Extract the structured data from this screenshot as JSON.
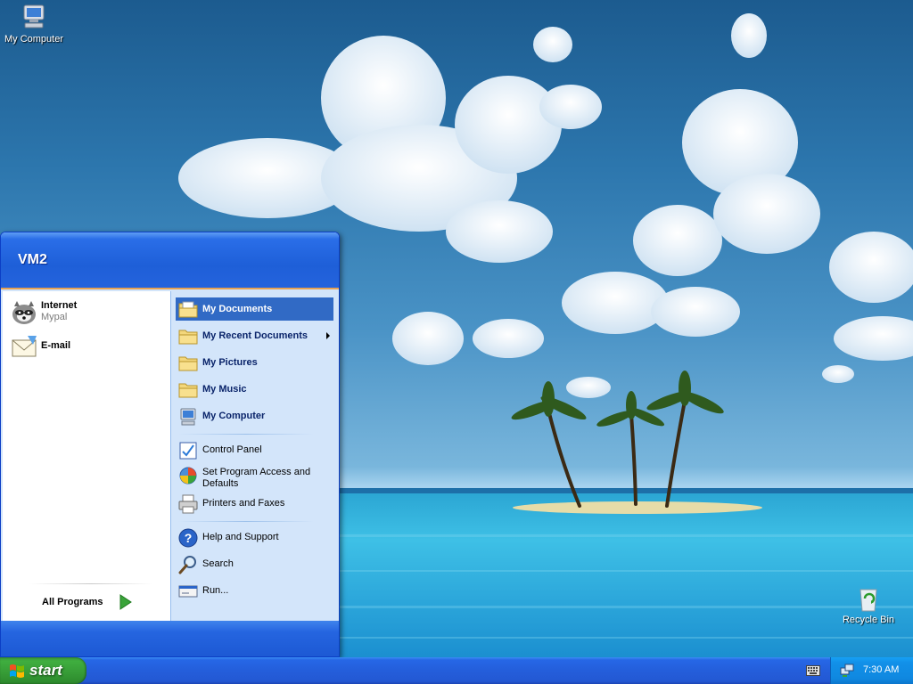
{
  "desktop": {
    "icons": [
      {
        "label": "My Computer"
      },
      {
        "label": "Recycle Bin"
      }
    ]
  },
  "start_menu": {
    "user_name": "VM2",
    "pinned": [
      {
        "title": "Internet",
        "subtitle": "Mypal",
        "icon": "raccoon-browser-icon"
      },
      {
        "title": "E-mail",
        "subtitle": "",
        "icon": "mail-envelope-icon"
      }
    ],
    "all_programs_label": "All Programs",
    "places": [
      {
        "label": "My Documents",
        "icon": "folder-documents-icon",
        "highlighted": true
      },
      {
        "label": "My Recent Documents",
        "icon": "folder-icon",
        "has_submenu": true
      },
      {
        "label": "My Pictures",
        "icon": "folder-icon"
      },
      {
        "label": "My Music",
        "icon": "folder-icon"
      },
      {
        "label": "My Computer",
        "icon": "computer-icon"
      }
    ],
    "settings": [
      {
        "label": "Control Panel",
        "icon": "control-panel-icon"
      },
      {
        "label": "Set Program Access and Defaults",
        "icon": "program-access-icon"
      },
      {
        "label": "Printers and Faxes",
        "icon": "printer-icon"
      }
    ],
    "help": [
      {
        "label": "Help and Support",
        "icon": "help-icon"
      },
      {
        "label": "Search",
        "icon": "search-icon"
      },
      {
        "label": "Run...",
        "icon": "run-icon"
      }
    ]
  },
  "taskbar": {
    "start_label": "start",
    "clock": "7:30 AM"
  },
  "colors": {
    "taskbar_blue": "#245edb",
    "start_green": "#3fae3f",
    "menu_highlight": "#316ac5",
    "tray_blue": "#1290e8"
  }
}
